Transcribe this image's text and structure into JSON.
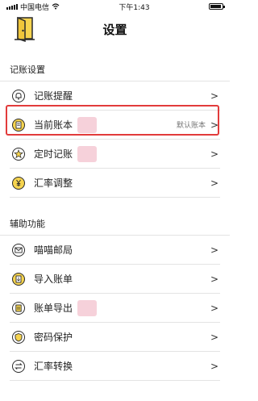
{
  "status_bar": {
    "carrier": "中国电信",
    "time": "下午1:43"
  },
  "header": {
    "title": "设置"
  },
  "sections": [
    {
      "title": "记账设置",
      "items": [
        {
          "label": "记账提醒",
          "icon": "bell-icon"
        },
        {
          "label": "当前账本",
          "icon": "clipboard-icon",
          "right_text": "默认账本"
        },
        {
          "label": "定时记账",
          "icon": "clock-icon"
        },
        {
          "label": "汇率调整",
          "icon": "yen-icon"
        }
      ]
    },
    {
      "title": "辅助功能",
      "items": [
        {
          "label": "喵喵邮局",
          "icon": "envelope-icon"
        },
        {
          "label": "导入账单",
          "icon": "import-icon"
        },
        {
          "label": "账单导出",
          "icon": "export-icon"
        },
        {
          "label": "密码保护",
          "icon": "lock-icon"
        },
        {
          "label": "汇率转换",
          "icon": "exchange-icon"
        }
      ]
    }
  ],
  "chevron": ">",
  "colors": {
    "highlight": "#e23b3b",
    "icon_bg": "#f6d44f"
  }
}
